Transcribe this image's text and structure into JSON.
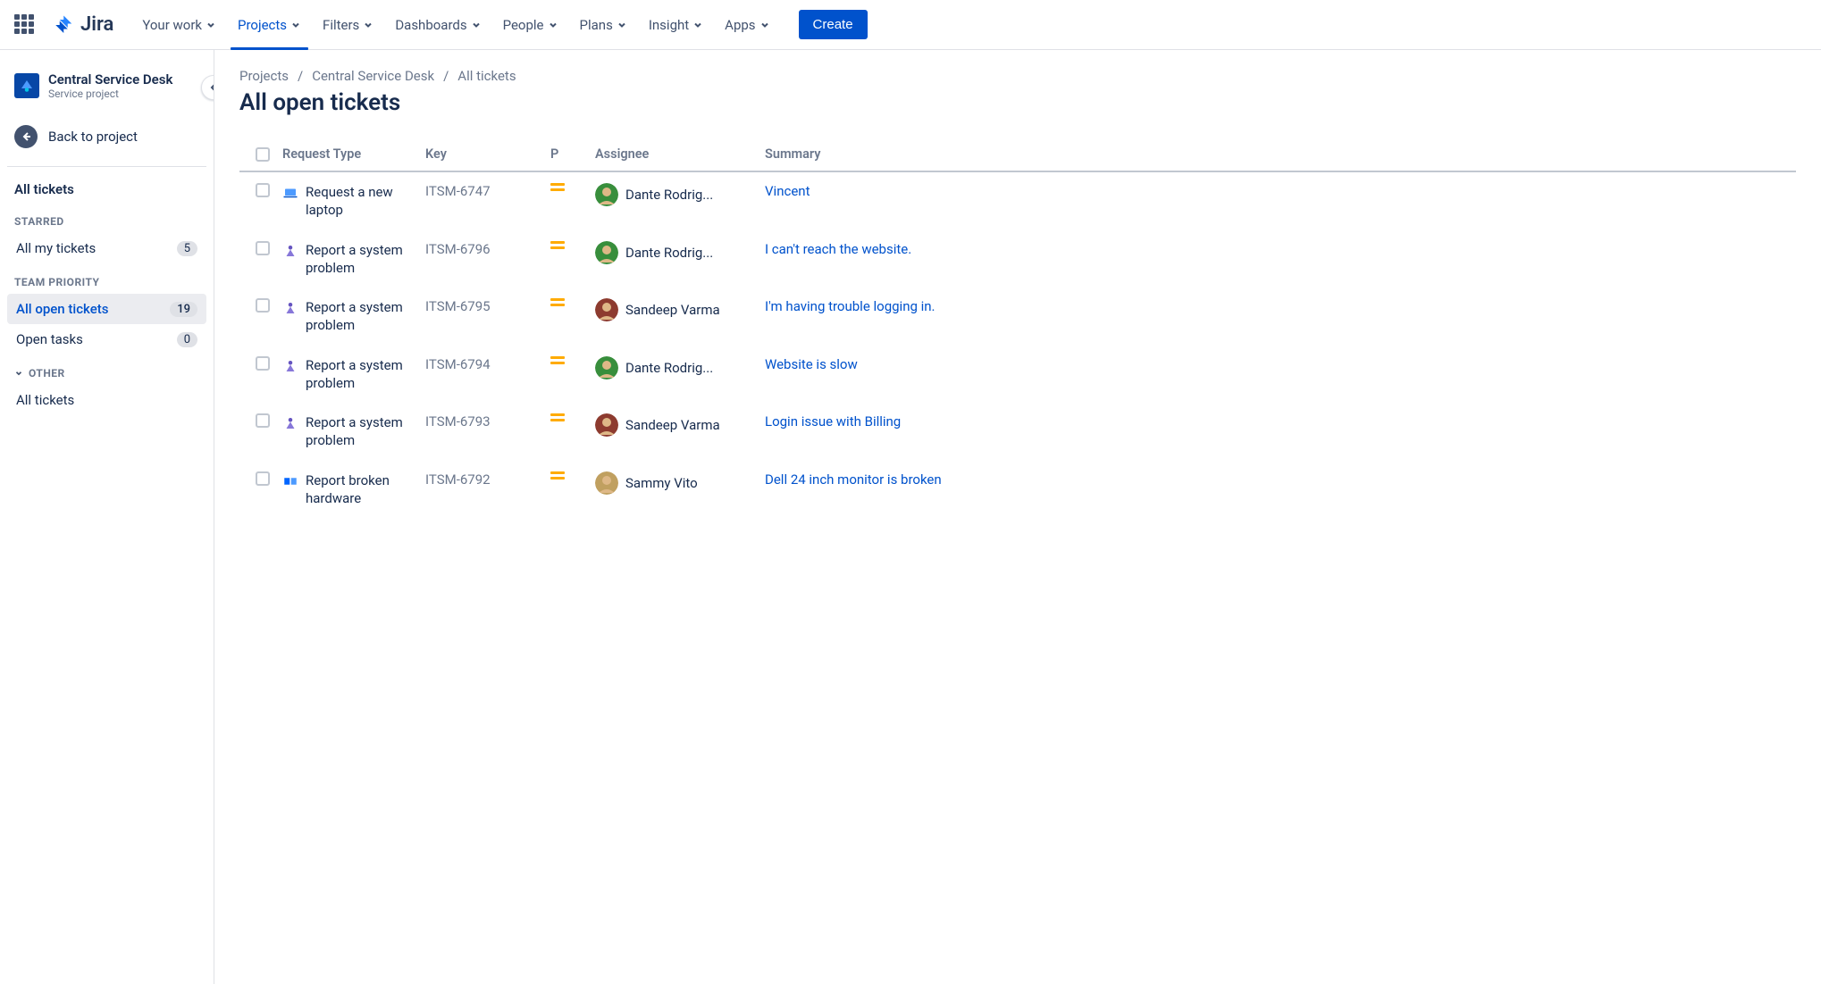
{
  "topnav": {
    "logo_text": "Jira",
    "items": [
      "Your work",
      "Projects",
      "Filters",
      "Dashboards",
      "People",
      "Plans",
      "Insight",
      "Apps"
    ],
    "active_index": 1,
    "create_label": "Create"
  },
  "sidebar": {
    "project_name": "Central Service Desk",
    "project_type": "Service project",
    "back_label": "Back to project",
    "all_tickets_label": "All tickets",
    "sections": [
      {
        "label": "STARRED",
        "items": [
          {
            "label": "All my tickets",
            "count": "5",
            "active": false
          }
        ]
      },
      {
        "label": "TEAM PRIORITY",
        "items": [
          {
            "label": "All open tickets",
            "count": "19",
            "active": true
          },
          {
            "label": "Open tasks",
            "count": "0",
            "active": false
          }
        ]
      },
      {
        "label": "OTHER",
        "collapsible": true,
        "items": [
          {
            "label": "All tickets",
            "count": "",
            "active": false
          }
        ]
      }
    ]
  },
  "breadcrumb": [
    "Projects",
    "Central Service Desk",
    "All tickets"
  ],
  "page_title": "All open tickets",
  "columns": {
    "type": "Request Type",
    "key": "Key",
    "p": "P",
    "assignee": "Assignee",
    "summary": "Summary"
  },
  "rows": [
    {
      "type_icon": "laptop",
      "type": "Request a new laptop",
      "key": "ITSM-6747",
      "assignee": "Dante Rodrig...",
      "avatar": "#388e3c",
      "summary": "Vincent"
    },
    {
      "type_icon": "system",
      "type": "Report a system problem",
      "key": "ITSM-6796",
      "assignee": "Dante Rodrig...",
      "avatar": "#388e3c",
      "summary": "I can't reach the website."
    },
    {
      "type_icon": "system",
      "type": "Report a system problem",
      "key": "ITSM-6795",
      "assignee": "Sandeep Varma",
      "avatar": "#8d3b2f",
      "summary": "I'm having trouble logging in."
    },
    {
      "type_icon": "system",
      "type": "Report a system problem",
      "key": "ITSM-6794",
      "assignee": "Dante Rodrig...",
      "avatar": "#388e3c",
      "summary": "Website is slow"
    },
    {
      "type_icon": "system",
      "type": "Report a system problem",
      "key": "ITSM-6793",
      "assignee": "Sandeep Varma",
      "avatar": "#8d3b2f",
      "summary": "Login issue with Billing"
    },
    {
      "type_icon": "hardware",
      "type": "Report broken hardware",
      "key": "ITSM-6792",
      "assignee": "Sammy Vito",
      "avatar": "#c0a060",
      "summary": "Dell 24 inch monitor is broken"
    }
  ]
}
